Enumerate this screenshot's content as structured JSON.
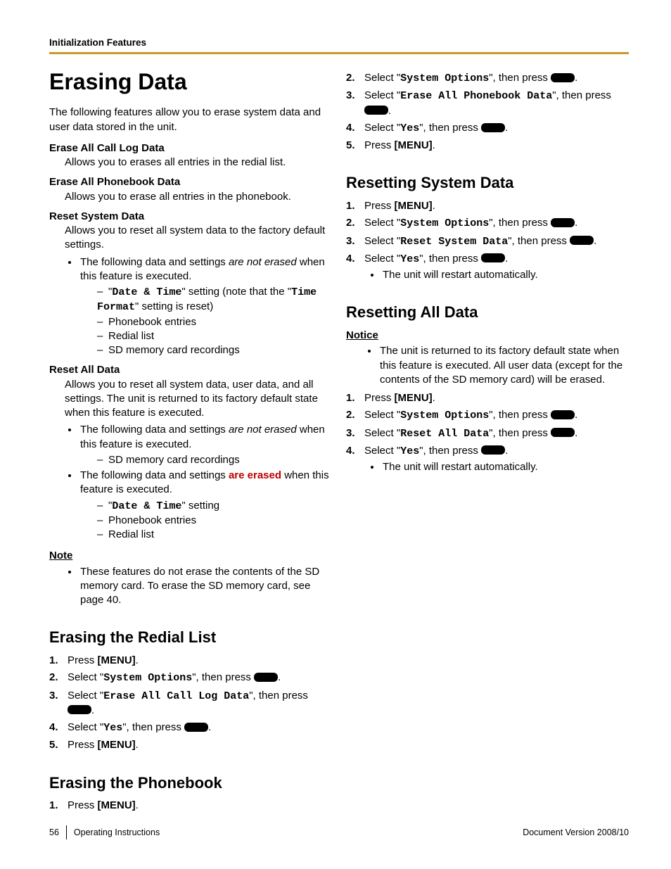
{
  "header": "Initialization Features",
  "title": "Erasing Data",
  "intro": "The following features allow you to erase system data and user data stored in the unit.",
  "defs": {
    "callLog": {
      "head": "Erase All Call Log Data",
      "body": "Allows you to erases all entries in the redial list."
    },
    "phonebook": {
      "head": "Erase All Phonebook Data",
      "body": "Allows you to erase all entries in the phonebook."
    },
    "resetSystem": {
      "head": "Reset System Data",
      "body": "Allows you to reset all system data to the factory default settings.",
      "bullet1a": "The following data and settings ",
      "bullet1b": "are not erased",
      "bullet1c": " when this feature is executed.",
      "dash1a": "\"",
      "dash1b": "Date & Time",
      "dash1c": "\" setting (note that the \"",
      "dash1d": "Time Format",
      "dash1e": "\" setting is reset)",
      "dash2": "Phonebook entries",
      "dash3": "Redial list",
      "dash4": "SD memory card recordings"
    },
    "resetAll": {
      "head": "Reset All Data",
      "body": "Allows you to reset all system data, user data, and all settings. The unit is returned to its factory default state when this feature is executed.",
      "bullet1a": "The following data and settings ",
      "bullet1b": "are not erased",
      "bullet1c": " when this feature is executed.",
      "dash1": "SD memory card recordings",
      "bullet2a": "The following data and settings ",
      "bullet2b": "are erased",
      "bullet2c": " when this feature is executed.",
      "dash2a": "\"",
      "dash2b": "Date & Time",
      "dash2c": "\" setting",
      "dash3": "Phonebook entries",
      "dash4": "Redial list"
    }
  },
  "note": {
    "label": "Note",
    "body": "These features do not erase the contents of the SD memory card. To erase the SD memory card, see page 40."
  },
  "sections": {
    "redial": {
      "title": "Erasing the Redial List",
      "s1a": "Press ",
      "s1b": "[MENU]",
      "s1c": ".",
      "s2a": "Select \"",
      "s2b": "System Options",
      "s2c": "\", then press ",
      "s3a": "Select \"",
      "s3b": "Erase All Call Log Data",
      "s3c": "\", then press ",
      "s4a": "Select \"",
      "s4b": "Yes",
      "s4c": "\", then press ",
      "s5a": "Press ",
      "s5b": "[MENU]",
      "s5c": "."
    },
    "phonebook": {
      "title": "Erasing the Phonebook",
      "s1a": "Press ",
      "s1b": "[MENU]",
      "s1c": ".",
      "s2a": "Select \"",
      "s2b": "System Options",
      "s2c": "\", then press ",
      "s3a": "Select \"",
      "s3b": "Erase All Phonebook Data",
      "s3c": "\", then press ",
      "s4a": "Select \"",
      "s4b": "Yes",
      "s4c": "\", then press ",
      "s5a": "Press ",
      "s5b": "[MENU]",
      "s5c": "."
    },
    "resetSys": {
      "title": "Resetting System Data",
      "s1a": "Press ",
      "s1b": "[MENU]",
      "s1c": ".",
      "s2a": "Select \"",
      "s2b": "System Options",
      "s2c": "\", then press ",
      "s3a": "Select \"",
      "s3b": "Reset System Data",
      "s3c": "\", then press ",
      "s4a": "Select \"",
      "s4b": "Yes",
      "s4c": "\", then press ",
      "sub": "The unit will restart automatically."
    },
    "resetAll": {
      "title": "Resetting All Data",
      "noticeLabel": "Notice",
      "notice": "The unit is returned to its factory default state when this feature is executed. All user data (except for the contents of the SD memory card) will be erased.",
      "s1a": "Press ",
      "s1b": "[MENU]",
      "s1c": ".",
      "s2a": "Select \"",
      "s2b": "System Options",
      "s2c": "\", then press ",
      "s3a": "Select \"",
      "s3b": "Reset All Data",
      "s3c": "\", then press ",
      "s4a": "Select \"",
      "s4b": "Yes",
      "s4c": "\", then press ",
      "sub": "The unit will restart automatically."
    }
  },
  "footer": {
    "page": "56",
    "doc": "Operating Instructions",
    "version": "Document Version   2008/10"
  },
  "period": "."
}
